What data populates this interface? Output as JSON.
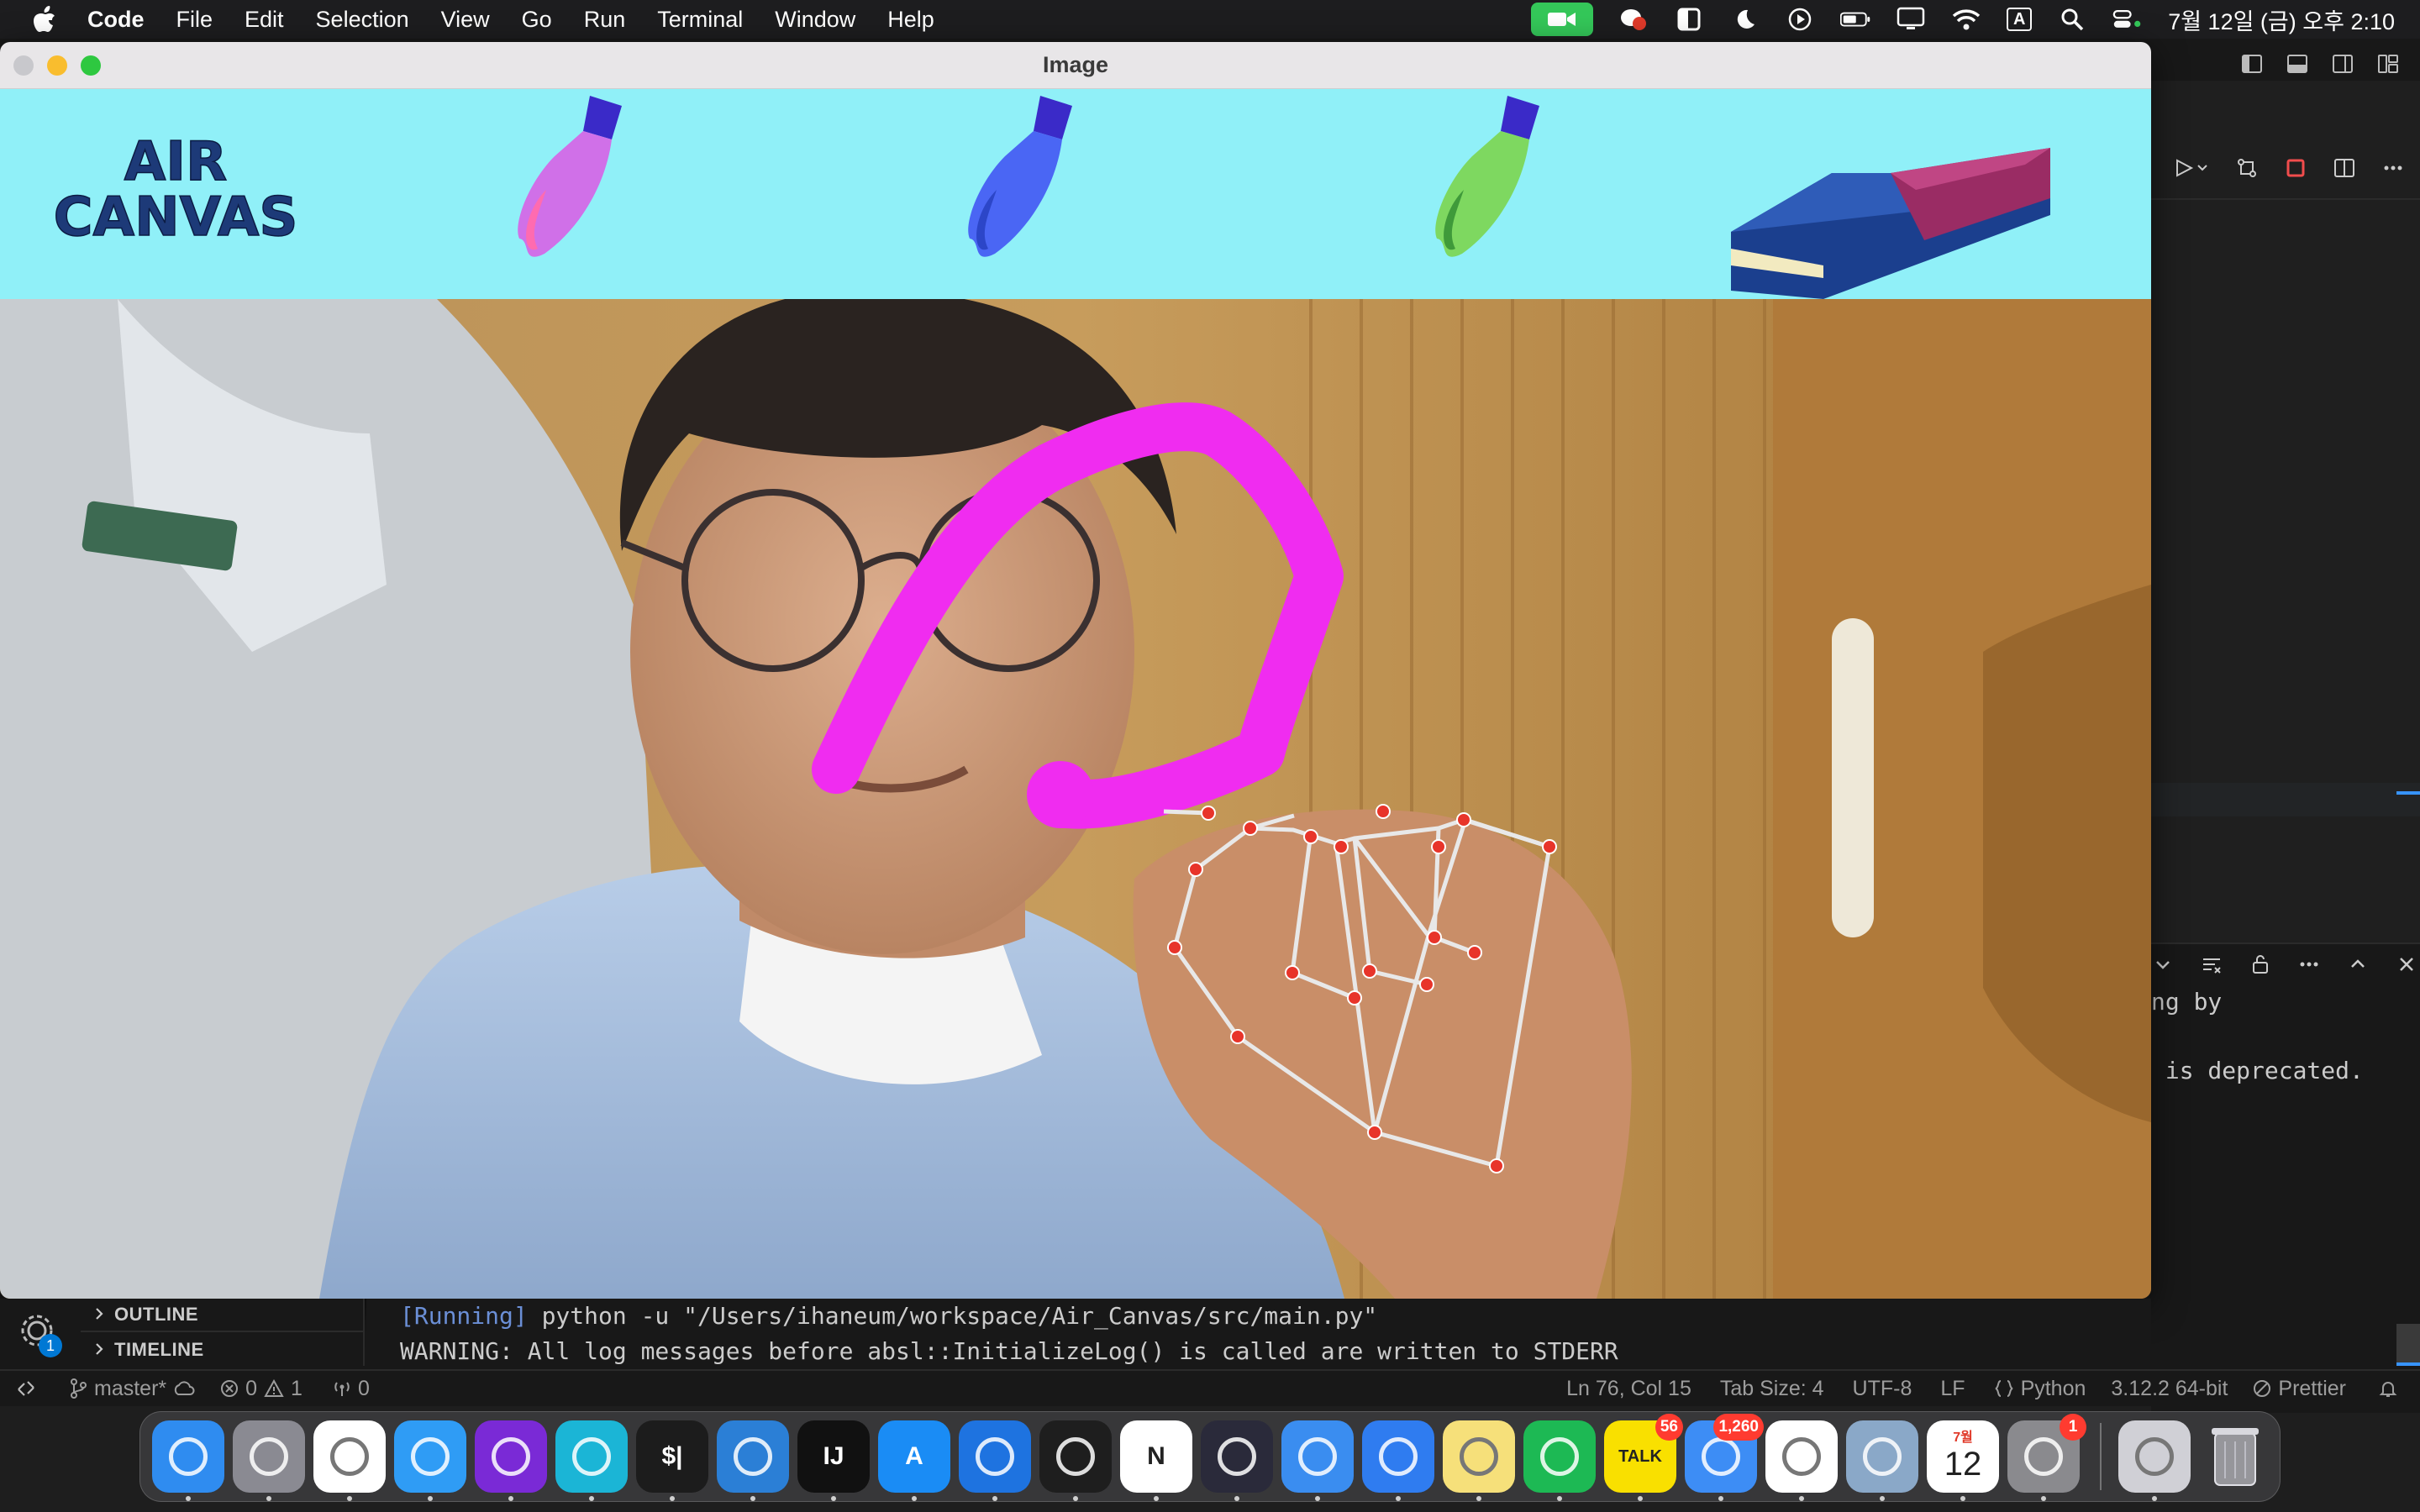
{
  "menubar": {
    "app_name": "Code",
    "items": [
      "File",
      "Edit",
      "Selection",
      "View",
      "Go",
      "Run",
      "Terminal",
      "Window",
      "Help"
    ],
    "input_source": "A",
    "clock": "7월 12일 (금) 오후 2:10"
  },
  "image_window": {
    "title": "Image",
    "logo_line1": "AIR",
    "logo_line2": "CANVAS",
    "brushes": [
      {
        "name": "pink-brush",
        "color": "#e060e8"
      },
      {
        "name": "blue-brush",
        "color": "#4a60f0"
      },
      {
        "name": "green-brush",
        "color": "#70d860"
      }
    ],
    "stroke_color": "#f02cf0"
  },
  "right_panel": {
    "line1": "ng by",
    "line2": " is deprecated."
  },
  "sidebar": {
    "outline_label": "OUTLINE",
    "timeline_label": "TIMELINE",
    "settings_badge": "1"
  },
  "terminal": {
    "running_tag": "[Running]",
    "command": " python -u \"/Users/ihaneum/workspace/Air_Canvas/src/main.py\"",
    "warning": "WARNING: All log messages before absl::InitializeLog() is called are written to STDERR"
  },
  "statusbar": {
    "branch": "master*",
    "errors": "0",
    "warnings": "1",
    "ports": "0",
    "cursor": "Ln 76, Col 15",
    "tab_size": "Tab Size: 4",
    "encoding": "UTF-8",
    "eol": "LF",
    "language": "Python",
    "interpreter": "3.12.2 64-bit",
    "formatter": "Prettier"
  },
  "dock": {
    "apps": [
      {
        "name": "finder",
        "label": "",
        "color": "#2f8cf0",
        "badge": ""
      },
      {
        "name": "launchpad",
        "label": "",
        "color": "#8a8a92",
        "badge": ""
      },
      {
        "name": "chrome",
        "label": "",
        "color": "#ffffff",
        "badge": ""
      },
      {
        "name": "safari",
        "label": "",
        "color": "#2f9cf5",
        "badge": ""
      },
      {
        "name": "firefox",
        "label": "",
        "color": "#7a2ad6",
        "badge": ""
      },
      {
        "name": "edge",
        "label": "",
        "color": "#1bb5d6",
        "badge": ""
      },
      {
        "name": "terminal",
        "label": "$|",
        "color": "#1c1c1c",
        "badge": ""
      },
      {
        "name": "vscode",
        "label": "",
        "color": "#2b7fd6",
        "badge": ""
      },
      {
        "name": "intellij",
        "label": "IJ",
        "color": "#111111",
        "badge": ""
      },
      {
        "name": "app-store",
        "label": "A",
        "color": "#1a8cf5",
        "badge": ""
      },
      {
        "name": "xcode",
        "label": "",
        "color": "#1e73e0",
        "badge": ""
      },
      {
        "name": "figma",
        "label": "",
        "color": "#1e1e1e",
        "badge": ""
      },
      {
        "name": "notion",
        "label": "N",
        "color": "#ffffff",
        "badge": ""
      },
      {
        "name": "obsidian",
        "label": "",
        "color": "#2a2a3a",
        "badge": ""
      },
      {
        "name": "finder-2",
        "label": "",
        "color": "#3a8df0",
        "badge": ""
      },
      {
        "name": "keynote",
        "label": "",
        "color": "#2f7cf0",
        "badge": ""
      },
      {
        "name": "notes",
        "label": "",
        "color": "#f6e07a",
        "badge": ""
      },
      {
        "name": "spotify",
        "label": "",
        "color": "#1db954",
        "badge": ""
      },
      {
        "name": "kakaotalk",
        "label": "TALK",
        "color": "#f9e000",
        "badge": "56"
      },
      {
        "name": "mail",
        "label": "",
        "color": "#3d8df5",
        "badge": "1,260"
      },
      {
        "name": "photos",
        "label": "",
        "color": "#ffffff",
        "badge": ""
      },
      {
        "name": "preview",
        "label": "",
        "color": "#8aa8c8",
        "badge": ""
      },
      {
        "name": "calendar",
        "label": "12",
        "color": "#ffffff",
        "badge": ""
      },
      {
        "name": "system-settings",
        "label": "",
        "color": "#8a8a8e",
        "badge": "1"
      },
      {
        "name": "rocket",
        "label": "",
        "color": "#d0d0d6",
        "badge": ""
      }
    ],
    "calendar_month": "7월",
    "trash": "trash"
  }
}
